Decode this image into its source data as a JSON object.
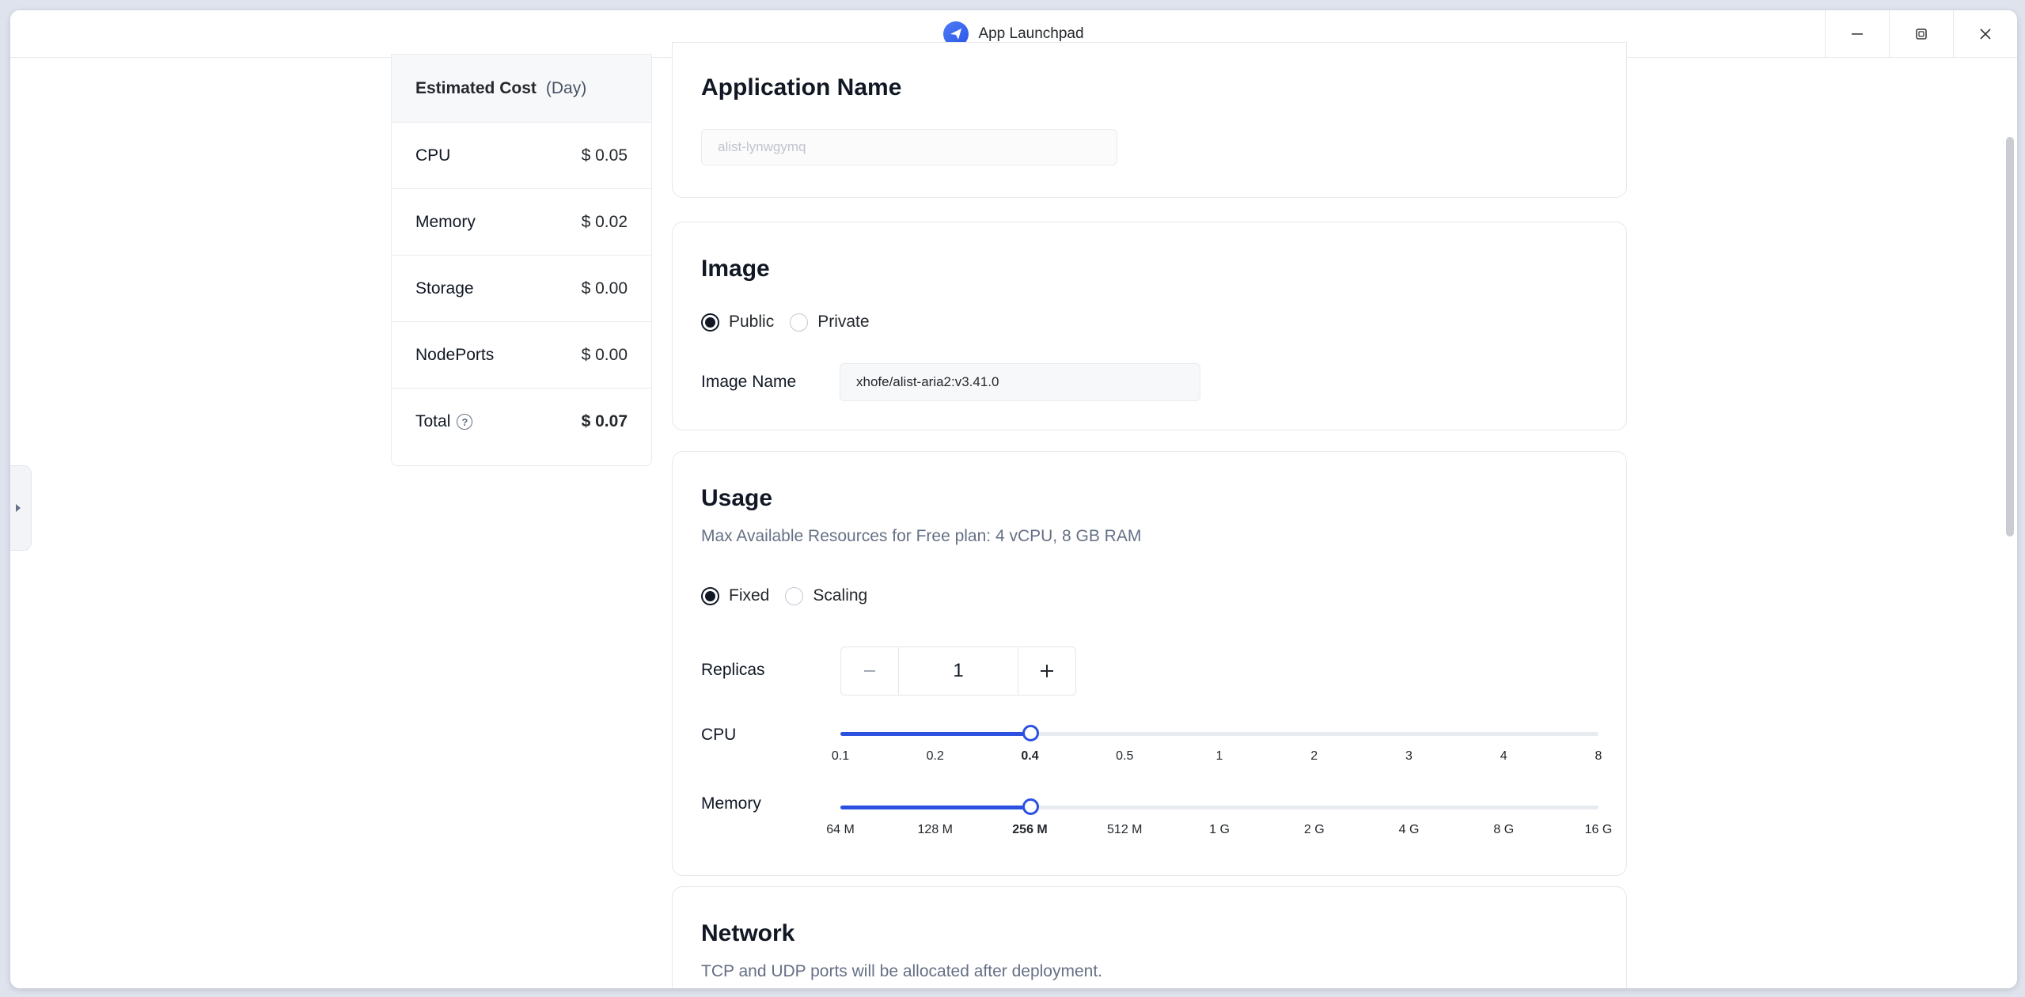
{
  "window": {
    "title": "App Launchpad"
  },
  "cost": {
    "title": "Estimated Cost",
    "period": "(Day)",
    "rows": [
      {
        "label": "CPU",
        "value": "$ 0.05"
      },
      {
        "label": "Memory",
        "value": "$ 0.02"
      },
      {
        "label": "Storage",
        "value": "$ 0.00"
      },
      {
        "label": "NodePorts",
        "value": "$ 0.00"
      }
    ],
    "total": {
      "label": "Total",
      "value": "$ 0.07",
      "help_icon": "question-circle-icon"
    }
  },
  "app_name": {
    "title": "Application Name",
    "value": "alist-lynwgymq"
  },
  "image": {
    "title": "Image",
    "options": [
      "Public",
      "Private"
    ],
    "selected": "Public",
    "name_label": "Image Name",
    "name_value": "xhofe/alist-aria2:v3.41.0"
  },
  "usage": {
    "title": "Usage",
    "hint": "Max Available Resources for Free plan: 4 vCPU, 8 GB RAM",
    "modes": [
      "Fixed",
      "Scaling"
    ],
    "selected_mode": "Fixed",
    "replicas_label": "Replicas",
    "replicas_value": "1",
    "cpu": {
      "label": "CPU",
      "marks": [
        "0.1",
        "0.2",
        "0.4",
        "0.5",
        "1",
        "2",
        "3",
        "4",
        "8"
      ],
      "selected": "0.4"
    },
    "memory": {
      "label": "Memory",
      "marks": [
        "64 M",
        "128 M",
        "256 M",
        "512 M",
        "1 G",
        "2 G",
        "4 G",
        "8 G",
        "16 G"
      ],
      "selected": "256 M"
    }
  },
  "network": {
    "title": "Network",
    "hint": "TCP and UDP ports will be allocated after deployment."
  },
  "colors": {
    "accent": "#2c51e0",
    "app_icon": "#3a63ee"
  }
}
